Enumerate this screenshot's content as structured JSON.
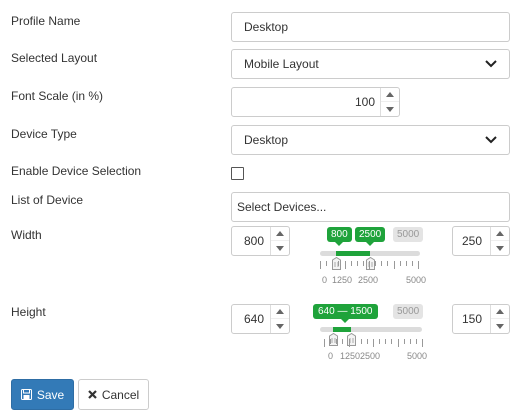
{
  "form": {
    "profile_name": {
      "label": "Profile Name",
      "value": "Desktop"
    },
    "selected_layout": {
      "label": "Selected Layout",
      "value": "Mobile Layout"
    },
    "font_scale": {
      "label": "Font Scale (in %)",
      "value": "100"
    },
    "device_type": {
      "label": "Device Type",
      "value": "Desktop"
    },
    "enable_device_selection": {
      "label": "Enable Device Selection",
      "checked": false
    },
    "list_of_device": {
      "label": "List of Device",
      "placeholder": "Select Devices..."
    },
    "width": {
      "label": "Width",
      "min_value": "800",
      "max_value": "250",
      "slider": {
        "range_min": 0,
        "range_max": 5000,
        "low": 800,
        "high": 2500,
        "low_tag": "800",
        "high_tag": "2500",
        "max_tag": "5000",
        "scale_labels": [
          "0",
          "1250",
          "2500",
          "5000"
        ]
      }
    },
    "height": {
      "label": "Height",
      "min_value": "640",
      "max_value": "150",
      "slider": {
        "range_min": 0,
        "range_max": 5000,
        "low": 640,
        "high": 1500,
        "range_tag": "640 — 1500",
        "max_tag": "5000",
        "scale_labels": [
          "0",
          "1250",
          "2500",
          "5000"
        ]
      }
    }
  },
  "actions": {
    "save_label": "Save",
    "cancel_label": "Cancel"
  },
  "colors": {
    "slider_green": "#1fa33b",
    "save_blue": "#337ab7"
  }
}
